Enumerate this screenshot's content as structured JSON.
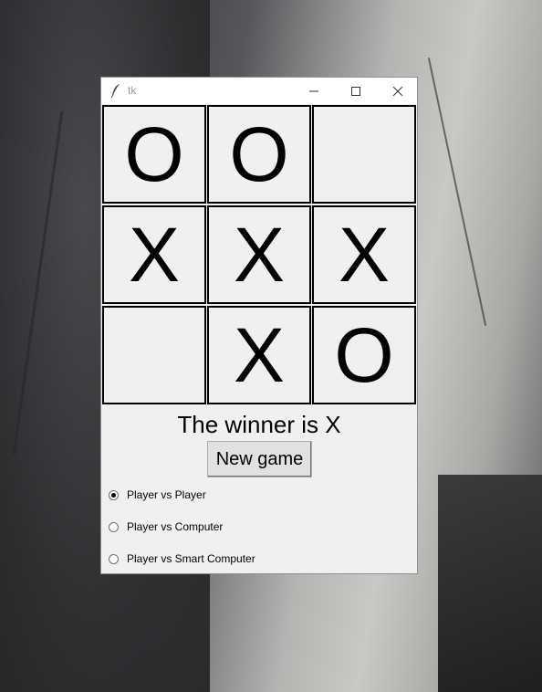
{
  "window": {
    "title": "tk"
  },
  "board": {
    "cells": [
      "O",
      "O",
      "",
      "X",
      "X",
      "X",
      "",
      "X",
      "O"
    ]
  },
  "status": "The winner is X",
  "new_game_label": "New game",
  "modes": [
    {
      "label": "Player vs Player",
      "selected": true
    },
    {
      "label": "Player vs Computer",
      "selected": false
    },
    {
      "label": "Player vs Smart Computer",
      "selected": false
    }
  ],
  "icons": {
    "app": "feather-icon",
    "minimize": "minimize-icon",
    "maximize": "maximize-icon",
    "close": "close-icon"
  }
}
